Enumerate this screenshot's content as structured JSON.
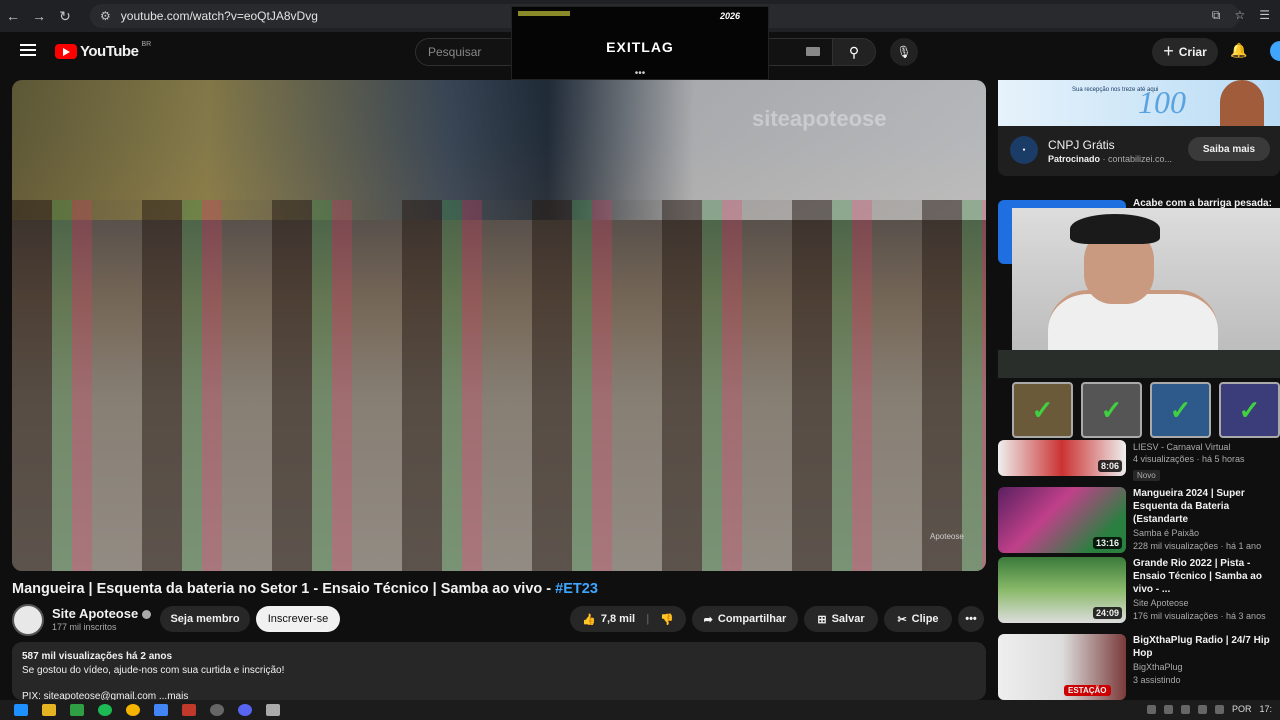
{
  "browser": {
    "url": "youtube.com/watch?v=eoQtJA8vDvg"
  },
  "overlay_app": {
    "logo": "EXITLAG",
    "badge": "2026",
    "dots": "•••"
  },
  "header": {
    "logo_text": "YouTube",
    "region": "BR",
    "search_placeholder": "Pesquisar",
    "create_label": "Criar"
  },
  "video": {
    "watermark": "siteapoteose",
    "corner_watermark": "Apoteose",
    "title": "Mangueira | Esquenta da bateria no Setor 1 - Ensaio Técnico | Samba ao vivo - ",
    "hashtag": "#ET23",
    "channel": "Site Apoteose",
    "subscribers": "177 mil inscritos",
    "join_label": "Seja membro",
    "subscribe_label": "Inscrever-se",
    "likes": "7,8 mil",
    "share_label": "Compartilhar",
    "save_label": "Salvar",
    "clip_label": "Clipe",
    "more_label": "•••",
    "description": {
      "stats": "587 mil visualizações  há 2 anos",
      "line1": "Se gostou do vídeo, ajude-nos com sua curtida e inscrição!",
      "line2": "PIX: siteapoteose@gmail.com     ...mais"
    }
  },
  "ad": {
    "banner_small": "Sua recepção nos treze até aqui",
    "banner_big": "100",
    "name": "CNPJ Grátis",
    "sponsored": "Patrocinado",
    "domain": " · contabilizei.co...",
    "cta": "Saiba mais"
  },
  "sidebar_overlay_title": "Acabe com a barriga pesada:",
  "recommendations": [
    {
      "title": "",
      "channel": "LIESV - Carnaval Virtual",
      "meta": "4 visualizações · há 5 horas",
      "badge": "Novo",
      "duration": "8:06"
    },
    {
      "title": "Mangueira 2024 | Super Esquenta da Bateria (Estandarte",
      "channel": "Samba é Paixão",
      "meta": "228 mil visualizações · há 1 ano",
      "duration": "13:16"
    },
    {
      "title": "Grande Rio 2022 | Pista - Ensaio Técnico | Samba ao vivo - ...",
      "channel": "Site Apoteose",
      "meta": "176 mil visualizações · há 3 anos",
      "duration": "24:09"
    },
    {
      "title": "BigXthaPlug Radio | 24/7 Hip Hop",
      "channel": "BigXthaPlug",
      "meta": "3 assistindo",
      "live": "ESTAÇÃO"
    }
  ],
  "taskbar": {
    "lang": "POR",
    "time": "17:"
  },
  "colors": {
    "accent": "#3ea6ff",
    "brand_red": "#ff0000"
  }
}
